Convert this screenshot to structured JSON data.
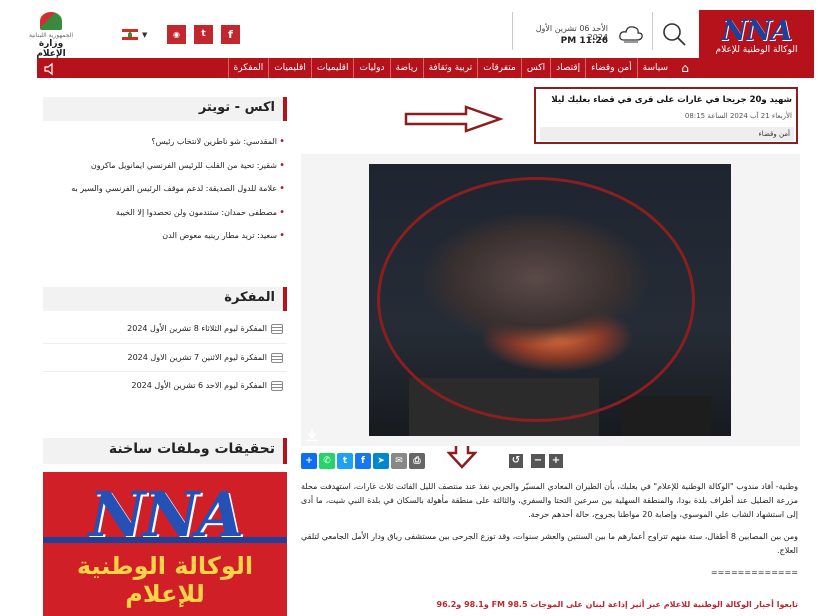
{
  "header": {
    "logo_text": "NNA",
    "logo_sub": "الوكالة الوطنية للإعلام",
    "date": "الأحد 06 تشرين الأول 2024",
    "time": "11:26 PM",
    "ministry_line1": "الجمهورية اللبنانية",
    "ministry_line2": "وزارة الإعلام",
    "social": [
      "f",
      "t",
      "rss"
    ],
    "accent": "#b5121b"
  },
  "nav": {
    "items": [
      "سياسة",
      "أمن وقضاء",
      "إقتصاد",
      "اكس",
      "متفرقات",
      "تربية وثقافة",
      "رياضة",
      "دوليات",
      "اقليميات",
      "اقليميات",
      "المفكرة"
    ]
  },
  "twitter": {
    "title": "اكس - تويتر",
    "items": [
      "المقدسي: شو ناطرين لانتخاب رئيس؟",
      "شقير: تحية من القلب للرئيس الفرنسي ايمانويل ماكرون",
      "علامة للدول الصديقة: لدعم موقف الرئيس الفرنسي والسير به",
      "مصطفى حمدان: ستندمون ولن تحصدوا إلا الخيبة",
      "سعيد: تريد مطار رينيه معوض الدن"
    ]
  },
  "agenda": {
    "title": "المفكرة",
    "items": [
      "المفكرة ليوم الثلاثاء 8 تشرين الأول 2024",
      "المفكرة ليوم الاثنين 7 تشرين الاول 2024",
      "المفكرة ليوم الاحد 6 تشرين الأول 2024"
    ]
  },
  "investigations": {
    "title": "تحقيقات وملفات ساخنة",
    "promo_logo": "NNA",
    "promo_text": "الوكالة الوطنية للإعلام"
  },
  "article": {
    "headline": "شهيد و20 جريحا في غارات على قرى في قضاء بعلبك ليلا",
    "date": "الأربعاء 21 آب 2024 الساعة 08:15",
    "category": "أمن وقضاء",
    "paragraph1": "وطنية- أفاد مندوب \"الوكالة الوطنية للإعلام\" في بعلبك، بأن الطيران المعادي المسيّر والحربي نفذ عند منتصف الليل الفائت ثلاث غارات، استهدفت محلة مزرعة الضليل عند أطراف بلدة بودا، والمنطقة السهلية بين سرعين التحتا والسفري، والثالثة على منطقة مأهولة بالسكان في بلدة النبي شيت، ما أدى إلى استشهاد الشاب علي الموسوي، وإصابة 20 مواطنا بجروح، حالة أحدهم حرجة.",
    "paragraph2": "ومن بين المصابين 8 أطفال، ستة منهم تتراوح أعمارهم ما بين السنتين والعشر سنوات، وقد توزع الجرحى بين مستشفى رياق ودار الأمل الجامعي لتلقي العلاج.",
    "separator": "=============",
    "footer": "تابعوا أخبار الوكالة الوطنية للاعلام عبر أثير إذاعة لبنان على الموجات FM 98.5 و98.1 و96.2"
  }
}
